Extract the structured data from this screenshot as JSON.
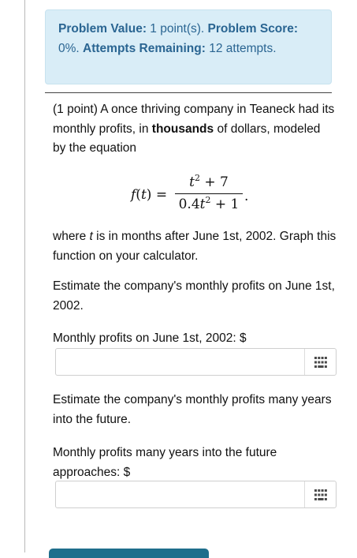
{
  "problem_info": {
    "value_label": "Problem Value:",
    "value_text": "1 point(s).",
    "score_label": "Problem Score:",
    "score_text": "0%.",
    "attempts_label": "Attempts Remaining:",
    "attempts_text": "12 attempts."
  },
  "problem": {
    "intro_prefix": "(1 point) A once thriving company in Teaneck had its monthly profits, in",
    "intro_bold": "thousands",
    "intro_suffix": "of dollars, modeled by the equation",
    "equation": {
      "lhs": "f(t) =",
      "numerator": "t² + 7",
      "denominator": "0.4t² + 1",
      "end": "."
    },
    "where_prefix": "where",
    "where_var": "t",
    "where_suffix": "is in months after June 1st, 2002. Graph this function on your calculator.",
    "question1": "Estimate the company's monthly profits on June 1st, 2002.",
    "label1": "Monthly profits on June 1st, 2002: $",
    "answer1": "",
    "question2": "Estimate the company's monthly profits many years into the future.",
    "label2": "Monthly profits many years into the future approaches: $",
    "answer2": ""
  },
  "icons": {
    "keypad": "keypad-grid-icon"
  },
  "colors": {
    "info_bg": "#d9edf7",
    "info_text": "#2a6592",
    "submit_button": "#1f6e8c"
  }
}
